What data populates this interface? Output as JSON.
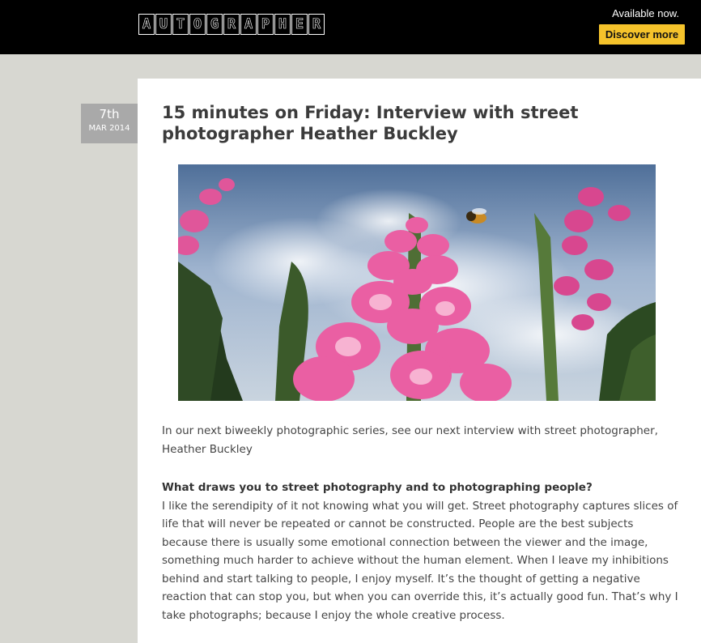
{
  "header": {
    "logo_letters": [
      "A",
      "U",
      "T",
      "O",
      "G",
      "R",
      "A",
      "P",
      "H",
      "E",
      "R"
    ],
    "available": "Available now.",
    "cta": "Discover more"
  },
  "post": {
    "date_day": "7th",
    "date_month": "MAR 2014",
    "title": "15 minutes on Friday: Interview with street photographer Heather Buckley",
    "intro": "In our next biweekly photographic series, see our next interview with street photographer, Heather Buckley",
    "question": "What draws you to street photography and to photographing people?",
    "answer": "I like the serendipity of it not knowing what you will get. Street photography captures slices of life that will never be repeated or cannot be constructed. People are the best subjects because there is usually some emotional connection between the viewer and the image, something much harder to achieve without the human element. When I leave my inhibitions behind and start talking to people, I enjoy myself. It’s the thought of getting a negative reaction that can stop you, but when you can override this, it’s actually  good fun. That’s why I take photographs; because I enjoy the whole creative process."
  },
  "colors": {
    "cta_bg": "#f5c32b",
    "topbar": "#000000",
    "page_bg": "#d7d7d1",
    "date_badge": "#a9a9a9"
  }
}
